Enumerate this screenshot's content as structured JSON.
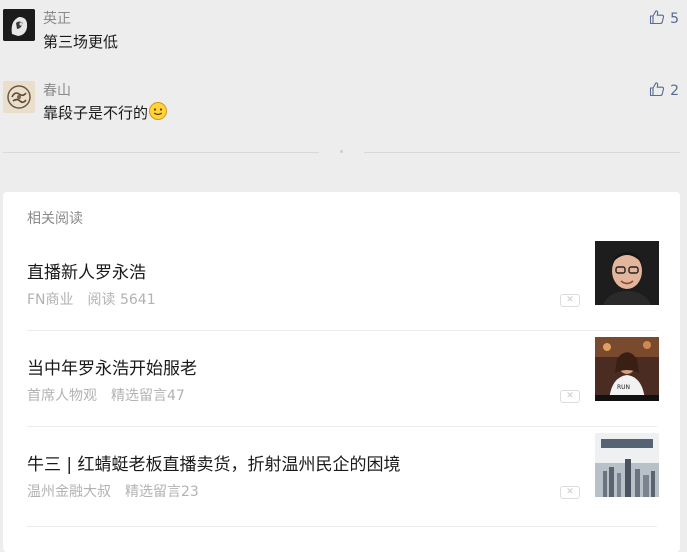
{
  "comments": [
    {
      "name": "英正",
      "text": "第三场更低",
      "likes": "5",
      "has_emoji": false
    },
    {
      "name": "春山",
      "text": "靠段子是不行的",
      "likes": "2",
      "has_emoji": true
    }
  ],
  "related": {
    "title": "相关阅读",
    "items": [
      {
        "title": "直播新人罗永浩",
        "source": "FN商业",
        "stat": "阅读 5641"
      },
      {
        "title": "当中年罗永浩开始服老",
        "source": "首席人物观",
        "stat": "精选留言47"
      },
      {
        "title": "牛三 | 红蜻蜓老板直播卖货，折射温州民企的困境",
        "source": "温州金融大叔",
        "stat": "精选留言23"
      }
    ]
  },
  "icons": {
    "like": "thumbs-up-icon",
    "close": "close-icon"
  },
  "colors": {
    "link_blue": "#576b95",
    "meta_gray": "#b2b2b2",
    "background": "#ededed"
  }
}
